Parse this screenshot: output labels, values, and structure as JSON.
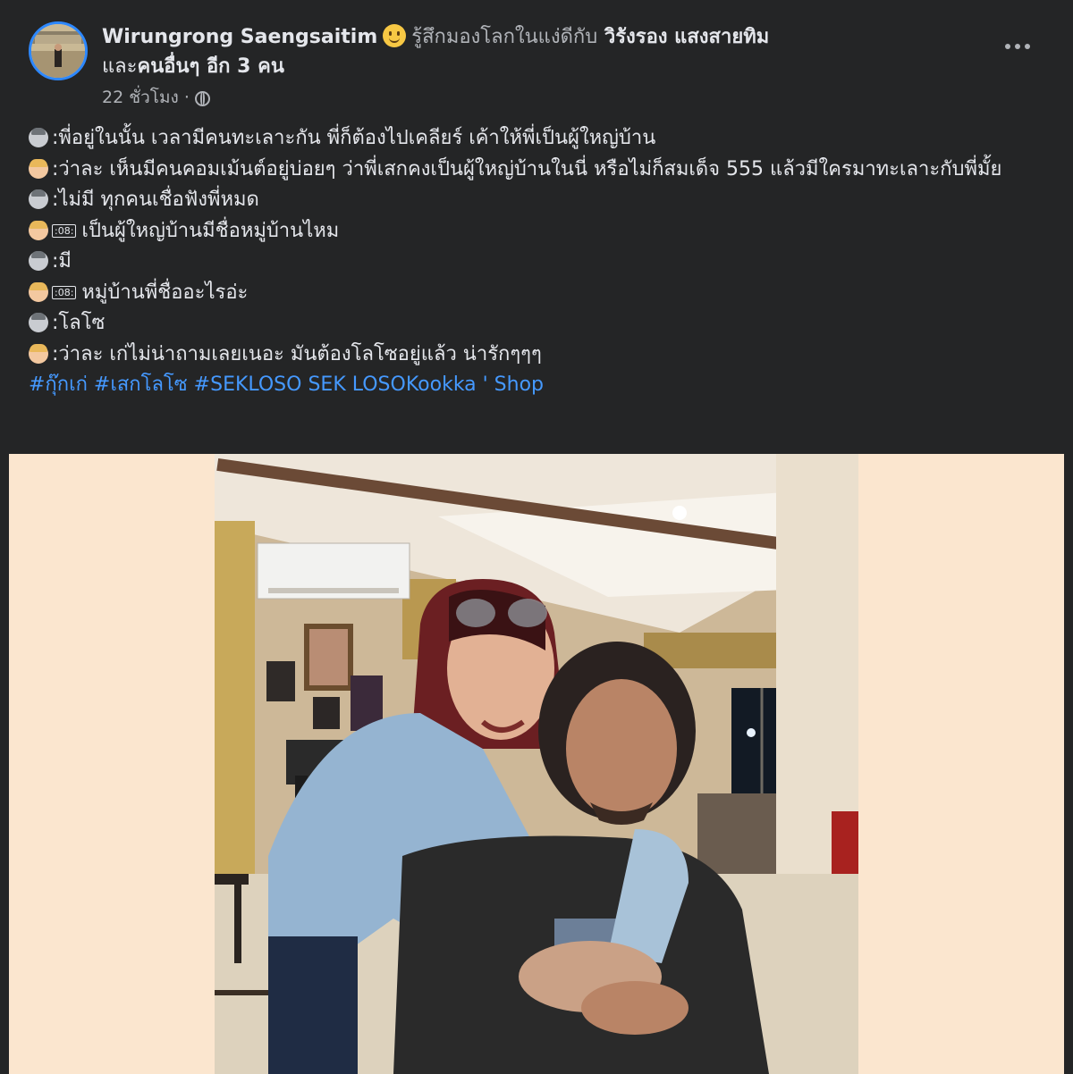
{
  "post": {
    "author": "Wirungrong Saengsaitim",
    "feeling": "รู้สึกมองโลกในแง่ดีกับ",
    "tagged_person": "วิรังรอง แสงสายทิม",
    "and_label": "และ",
    "others": "คนอื่นๆ อีก 3 คน",
    "time": "22 ชั่วโมง",
    "separator": "·",
    "feeling_icon": "smiling-face-icon",
    "privacy_icon": "globe-icon",
    "menu_icon": "more-options-icon"
  },
  "dialogue": [
    {
      "speaker": "man",
      "tag": "",
      "text": ":พี่อยู่ในนั้น เวลามีคนทะเลาะกัน พี่ก็ต้องไปเคลียร์ เค้าให้พี่เป็นผู้ใหญ่บ้าน"
    },
    {
      "speaker": "woman",
      "tag": "",
      "text": ":ว่าละ เห็นมีคนคอมเม้นต์อยู่บ่อยๆ ว่าพี่เสกคงเป็นผู้ใหญ่บ้านในนี่ หรือไม่ก็สมเด็จ 555 แล้วมีใครมาทะเลาะกับพี่มั้ย"
    },
    {
      "speaker": "man",
      "tag": "",
      "text": ":ไม่มี ทุกคนเชื่อฟังพี่หมด"
    },
    {
      "speaker": "woman",
      "tag": ":08:",
      "text": "เป็นผู้ใหญ่บ้านมีชื่อหมู่บ้านไหม"
    },
    {
      "speaker": "man",
      "tag": "",
      "text": ":มี"
    },
    {
      "speaker": "woman",
      "tag": ":08:",
      "text": "หมู่บ้านพี่ชื่ออะไรอ่ะ"
    },
    {
      "speaker": "man",
      "tag": "",
      "text": ":โลโซ"
    },
    {
      "speaker": "woman",
      "tag": "",
      "text": ":ว่าละ เก่ไม่น่าถามเลยเนอะ มันต้องโลโซอยู่แล้ว น่ารักๆๆๆ"
    }
  ],
  "hashtags": [
    "#กุ๊กเก่",
    "#เสกโลโซ",
    "#SEKLOSO",
    "SEK LOSOKookka ' Shop"
  ],
  "colors": {
    "background": "#242526",
    "text": "#e4e6eb",
    "secondary": "#b0b3b8",
    "link": "#4599ff",
    "photo_letterbox": "#fbe6cf"
  }
}
